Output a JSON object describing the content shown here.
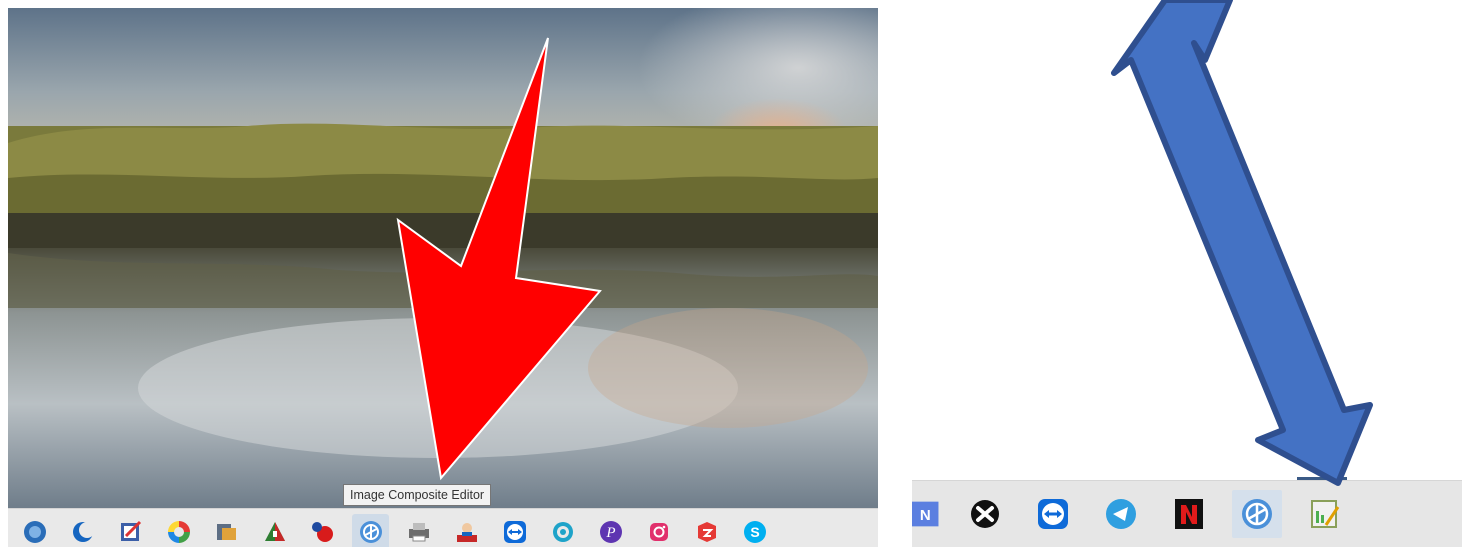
{
  "tooltip": {
    "text": "Image Composite Editor"
  },
  "left_taskbar": {
    "icons": [
      "windows-orb-icon",
      "moon-crescent-icon",
      "paint-editor-icon",
      "picasa-icon",
      "film-editor-icon",
      "photo-tile-icon",
      "red-ball-icon",
      "image-composite-editor-icon",
      "printer-scanner-icon",
      "accounting-app-icon",
      "teamviewer-icon",
      "snipping-circle-icon",
      "purple-p-icon",
      "instagram-icon",
      "red-3d-icon",
      "skype-partial-icon"
    ],
    "active_index": 7
  },
  "right_taskbar": {
    "icons": [
      "blue-n-app-icon",
      "x-circle-app-icon",
      "teamviewer-icon",
      "telegram-icon",
      "red-m-app-icon",
      "image-composite-editor-icon",
      "chart-tool-icon"
    ],
    "active_index": 5
  },
  "annotations": {
    "red_arrow_color": "#ff0000",
    "blue_arrow_color": "#4472c4",
    "blue_arrow_outline": "#2f4f8f"
  }
}
